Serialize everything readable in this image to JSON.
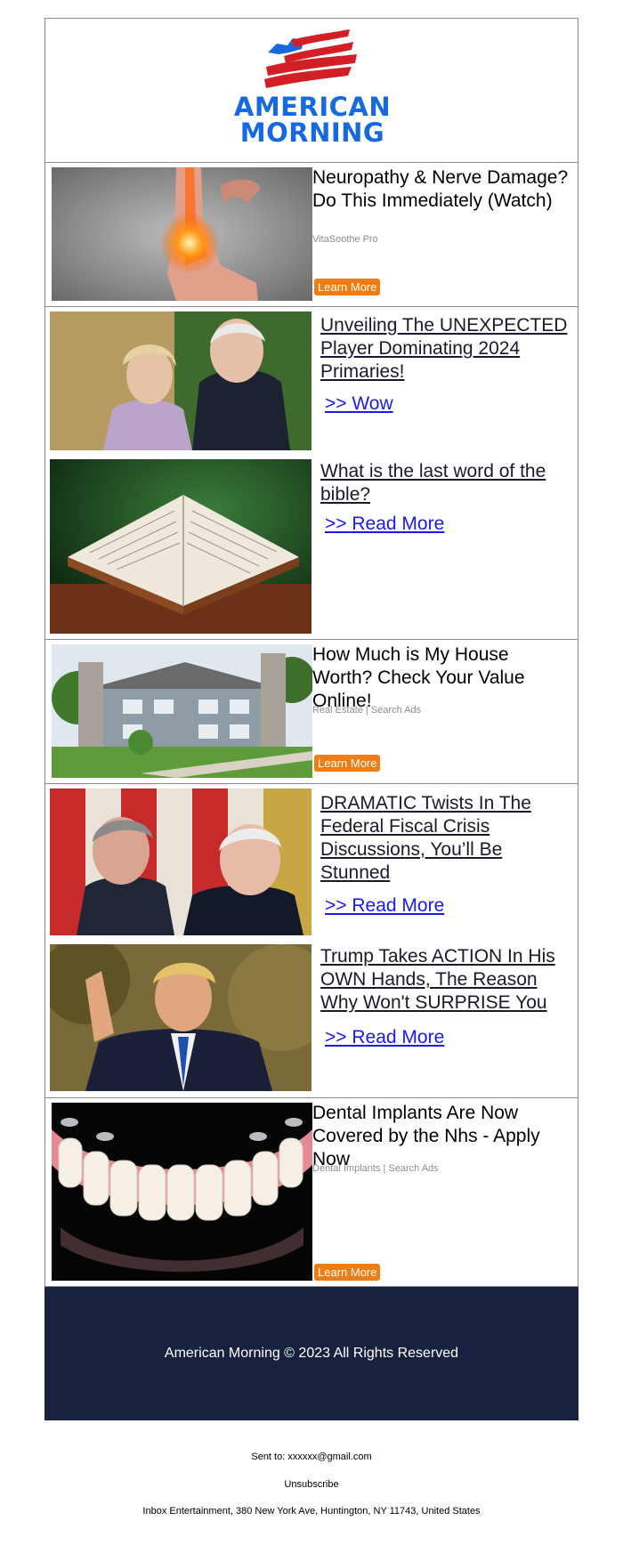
{
  "brand": {
    "line1": "AMERICAN",
    "line2": "MORNING",
    "logo_color": "#1769e0",
    "flag_red": "#d21f26"
  },
  "ads": [
    {
      "title": "Neuropathy & Nerve Damage? Do This Immediately (Watch)",
      "source": "VitaSoothe Pro",
      "button": "Learn More"
    },
    {
      "title": "How Much is My House Worth? Check Your Value Online!",
      "source": "Real Estate | Search Ads",
      "button": "Learn More"
    },
    {
      "title": "Dental Implants Are Now Covered by the Nhs - Apply Now",
      "source": "Dental Implants | Search Ads",
      "button": "Learn More"
    }
  ],
  "articles": [
    {
      "title": "Unveiling The UNEXPECTED Player Dominating 2024 Primaries!",
      "link": ">> Wow"
    },
    {
      "title": "What is the last word of the bible?",
      "link": ">> Read More"
    },
    {
      "title": "DRAMATIC Twists In The Federal Fiscal Crisis Discussions, You’ll Be Stunned",
      "link": ">> Read More"
    },
    {
      "title": "Trump Takes ACTION In His OWN Hands, The Reason Why Won't SURPRISE You",
      "link": ">> Read More"
    }
  ],
  "footer": {
    "copyright": "American Morning © 2023 All Rights Reserved"
  },
  "bottom": {
    "sent_to": "Sent to: xxxxxx@gmail.com",
    "unsubscribe": "Unsubscribe",
    "address": "Inbox Entertainment, 380 New York Ave, Huntington, NY 11743, United States"
  },
  "colors": {
    "button": "#ef7d11",
    "footer_bg": "#18213e",
    "link": "#1a1aee"
  }
}
